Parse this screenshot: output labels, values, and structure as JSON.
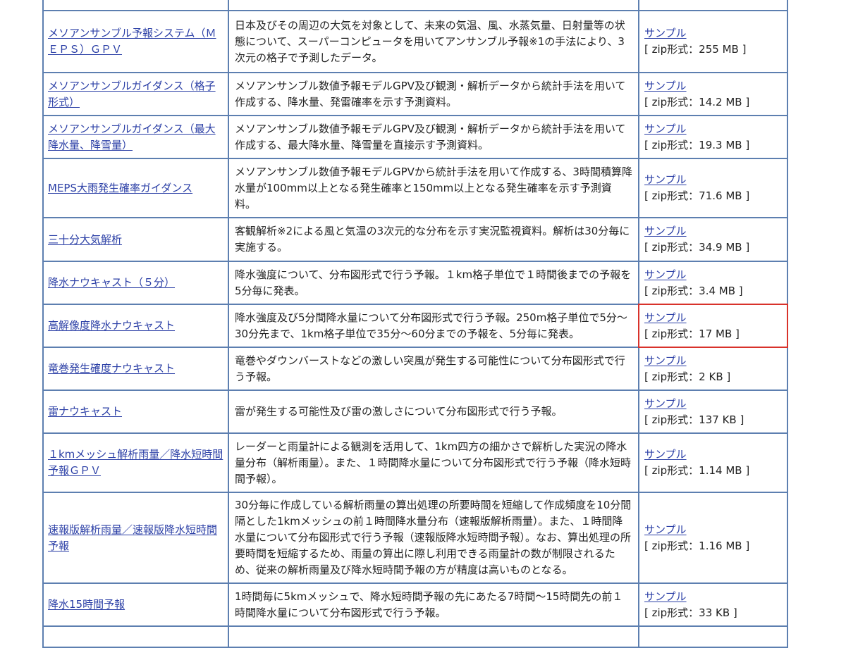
{
  "rows": [
    {
      "name": "",
      "desc": "",
      "sample": "",
      "size": ""
    },
    {
      "name": "メソアンサンブル予報システム（ＭＥＰＳ）ＧＰＶ",
      "desc": "日本及びその周辺の大気を対象として、未来の気温、風、水蒸気量、日射量等の状態について、スーパーコンピュータを用いてアンサンブル予報※1の手法により、3次元の格子で予測したデータ。",
      "sample": "サンプル",
      "size": "[ zip形式：255 MB ]"
    },
    {
      "name": "メソアンサンブルガイダンス（格子形式）",
      "desc": "メソアンサンブル数値予報モデルGPV及び観測・解析データから統計手法を用いて作成する、降水量、発雷確率を示す予測資料。",
      "sample": "サンプル",
      "size": "[ zip形式：14.2 MB ]"
    },
    {
      "name": "メソアンサンブルガイダンス（最大降水量、降雪量）",
      "desc": "メソアンサンブル数値予報モデルGPV及び観測・解析データから統計手法を用いて作成する、最大降水量、降雪量を直接示す予測資料。",
      "sample": "サンプル",
      "size": "[ zip形式：19.3 MB ]"
    },
    {
      "name": "MEPS大雨発生確率ガイダンス",
      "desc": "メソアンサンブル数値予報モデルGPVから統計手法を用いて作成する、3時間積算降水量が100mm以上となる発生確率と150mm以上となる発生確率を示す予測資料。",
      "sample": "サンプル",
      "size": "[ zip形式：71.6 MB ]"
    },
    {
      "name": "三十分大気解析",
      "desc": "客観解析※2による風と気温の3次元的な分布を示す実況監視資料。解析は30分毎に実施する。",
      "sample": "サンプル",
      "size": "[ zip形式：34.9 MB ]"
    },
    {
      "name": "降水ナウキャスト（５分）",
      "desc": "降水強度について、分布図形式で行う予報。１km格子単位で１時間後までの予報を5分毎に発表。",
      "sample": "サンプル",
      "size": "[ zip形式：3.4 MB ]"
    },
    {
      "name": "高解像度降水ナウキャスト",
      "desc": "降水強度及び5分間降水量について分布図形式で行う予報。250m格子単位で5分〜30分先まで、1km格子単位で35分〜60分までの予報を、5分毎に発表。",
      "sample": "サンプル",
      "size": "[ zip形式：17 MB ]"
    },
    {
      "name": "竜巻発生確度ナウキャスト",
      "desc": "竜巻やダウンバーストなどの激しい突風が発生する可能性について分布図形式で行う予報。",
      "sample": "サンプル",
      "size": "[ zip形式：2 KB ]"
    },
    {
      "name": "雷ナウキャスト",
      "desc": "雷が発生する可能性及び雷の激しさについて分布図形式で行う予報。",
      "sample": "サンプル",
      "size": "[ zip形式：137 KB ]"
    },
    {
      "name": "１kmメッシュ解析雨量／降水短時間予報ＧＰＶ",
      "desc": "レーダーと雨量計による観測を活用して、1km四方の細かさで解析した実況の降水量分布（解析雨量）。また、１時間降水量について分布図形式で行う予報（降水短時間予報）。",
      "sample": "サンプル",
      "size": "[ zip形式：1.14 MB ]"
    },
    {
      "name": "速報版解析雨量／速報版降水短時間予報",
      "desc": "30分毎に作成している解析雨量の算出処理の所要時間を短縮して作成頻度を10分間隔とした1kmメッシュの前１時間降水量分布（速報版解析雨量）。また、１時間降水量について分布図形式で行う予報（速報版降水短時間予報）。なお、算出処理の所要時間を短縮するため、雨量の算出に際し利用できる雨量計の数が制限されるため、従来の解析雨量及び降水短時間予報の方が精度は高いものとなる。",
      "sample": "サンプル",
      "size": "[ zip形式：1.16 MB ]"
    },
    {
      "name": "降水15時間予報",
      "desc": "1時間毎に5kmメッシュで、降水短時間予報の先にあたる7時間〜15時間先の前１時間降水量について分布図形式で行う予報。",
      "sample": "サンプル",
      "size": "[ zip形式：33 KB ]"
    },
    {
      "name": "",
      "desc": "",
      "sample": "",
      "size": ""
    }
  ]
}
